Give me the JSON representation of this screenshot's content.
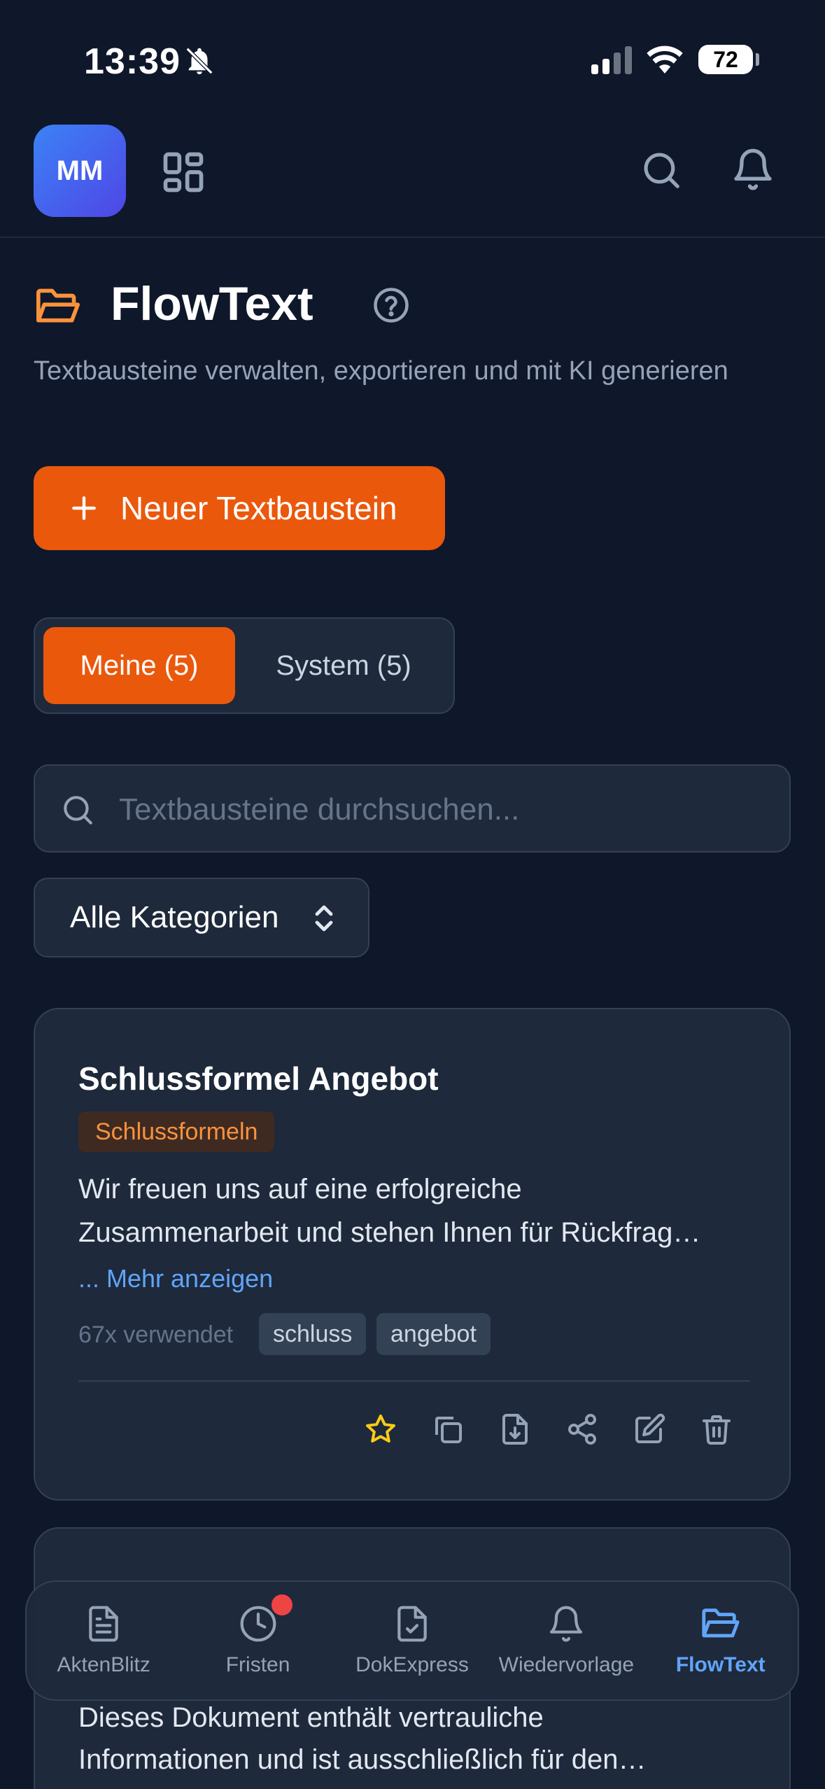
{
  "status_bar": {
    "time": "13:39",
    "battery": "72"
  },
  "top_nav": {
    "avatar_initials": "MM"
  },
  "page": {
    "title": "FlowText",
    "subtitle": "Textbausteine verwalten, exportieren und mit KI generieren",
    "new_button_label": "Neuer Textbaustein"
  },
  "tabs": [
    {
      "label": "Meine (5)",
      "active": true
    },
    {
      "label": "System (5)",
      "active": false
    }
  ],
  "search": {
    "placeholder": "Textbausteine durchsuchen...",
    "value": ""
  },
  "category_filter": {
    "selected": "Alle Kategorien"
  },
  "cards": [
    {
      "title": "Schlussformel Angebot",
      "category": "Schlussformeln",
      "text_line1": "Wir freuen uns auf eine erfolgreiche",
      "text_line2": "Zusammenarbeit und stehen Ihnen für Rückfrag…",
      "more_label": "... Mehr anzeigen",
      "usage": "67x verwendet",
      "tags": [
        "schluss",
        "angebot"
      ]
    },
    {
      "text_line1": "Dieses Dokument enthält vertrauliche",
      "text_line2": "Informationen und ist ausschließlich für den…"
    }
  ],
  "bottom_nav": [
    {
      "label": "AktenBlitz",
      "icon": "document-icon"
    },
    {
      "label": "Fristen",
      "icon": "clock-icon",
      "has_badge": true
    },
    {
      "label": "DokExpress",
      "icon": "document-check-icon"
    },
    {
      "label": "Wiedervorlage",
      "icon": "bell-icon"
    },
    {
      "label": "FlowText",
      "icon": "folder-open-icon",
      "active": true
    }
  ],
  "colors": {
    "accent": "#ea580c",
    "active_nav": "#60a5fa",
    "background": "#0f172a",
    "card": "#1e293b"
  }
}
